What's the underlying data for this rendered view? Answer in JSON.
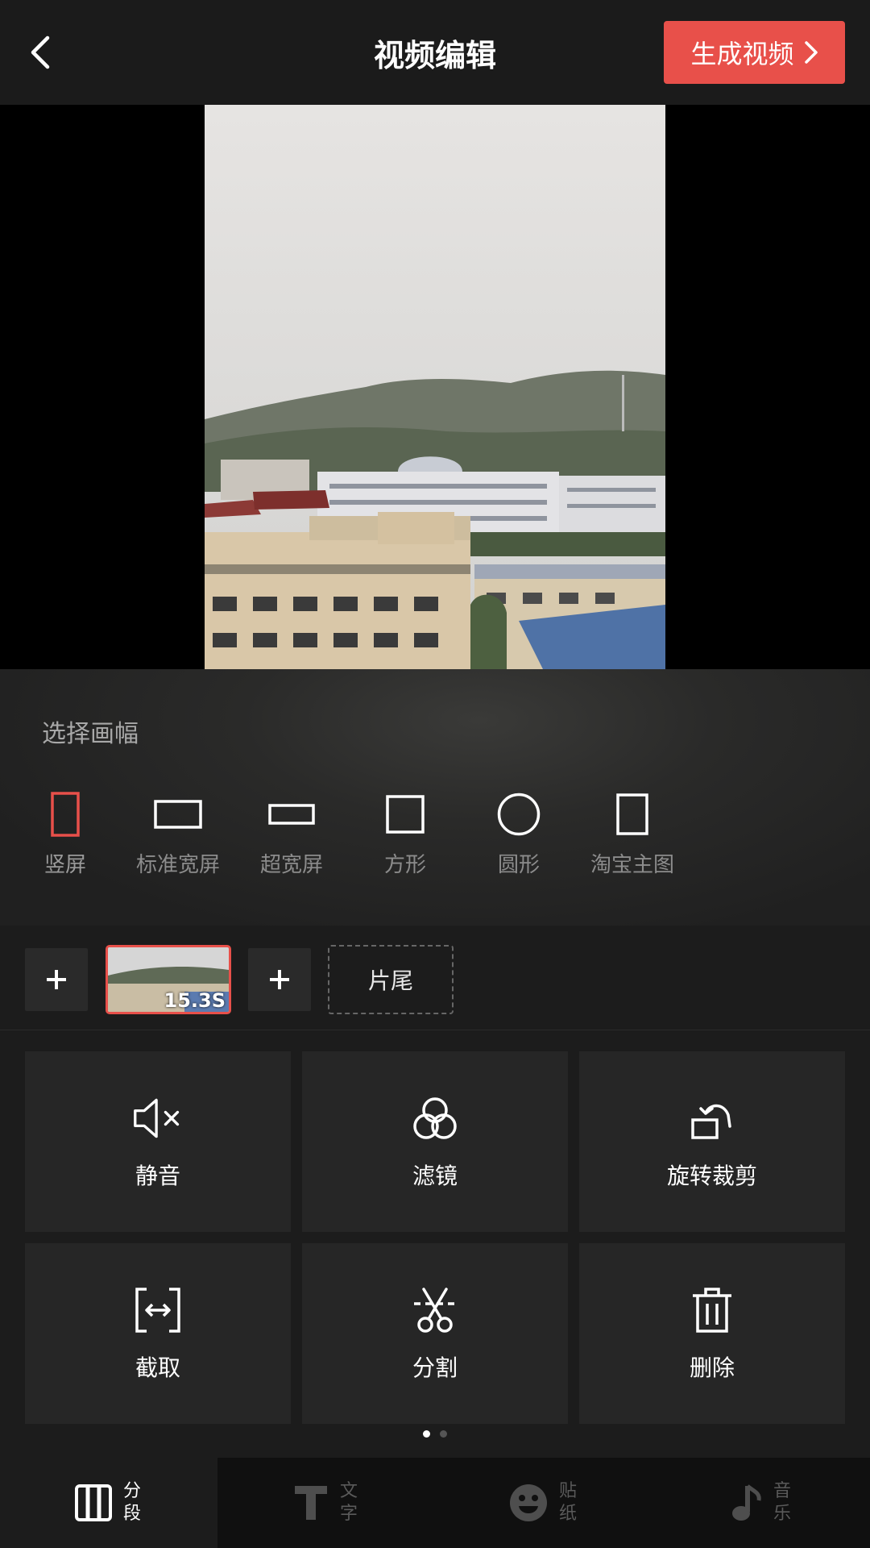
{
  "header": {
    "title": "视频编辑",
    "generate_label": "生成视频"
  },
  "aspect": {
    "title": "选择画幅",
    "options": [
      {
        "label": "竖屏",
        "icon": "portrait-rect-icon",
        "selected": true
      },
      {
        "label": "标准宽屏",
        "icon": "widescreen-rect-icon",
        "selected": false
      },
      {
        "label": "超宽屏",
        "icon": "ultrawide-rect-icon",
        "selected": false
      },
      {
        "label": "方形",
        "icon": "square-icon",
        "selected": false
      },
      {
        "label": "圆形",
        "icon": "circle-icon",
        "selected": false
      },
      {
        "label": "淘宝主图",
        "icon": "taobao-rect-icon",
        "selected": false
      }
    ]
  },
  "timeline": {
    "clip_duration": "15.3S",
    "trailer_label": "片尾"
  },
  "tools": [
    {
      "label": "静音",
      "icon": "mute-icon"
    },
    {
      "label": "滤镜",
      "icon": "filter-icon"
    },
    {
      "label": "旋转裁剪",
      "icon": "rotate-crop-icon"
    },
    {
      "label": "截取",
      "icon": "trim-icon"
    },
    {
      "label": "分割",
      "icon": "scissors-icon"
    },
    {
      "label": "删除",
      "icon": "trash-icon"
    }
  ],
  "pager": {
    "page": 1,
    "total": 2
  },
  "bottom_nav": [
    {
      "top": "分",
      "bottom": "段",
      "icon": "segments-icon",
      "active": true
    },
    {
      "top": "文",
      "bottom": "字",
      "icon": "text-icon",
      "active": false
    },
    {
      "top": "贴",
      "bottom": "纸",
      "icon": "sticker-icon",
      "active": false
    },
    {
      "top": "音",
      "bottom": "乐",
      "icon": "music-icon",
      "active": false
    }
  ],
  "colors": {
    "accent": "#e8504a",
    "background": "#1c1c1c",
    "tile": "#262626"
  }
}
